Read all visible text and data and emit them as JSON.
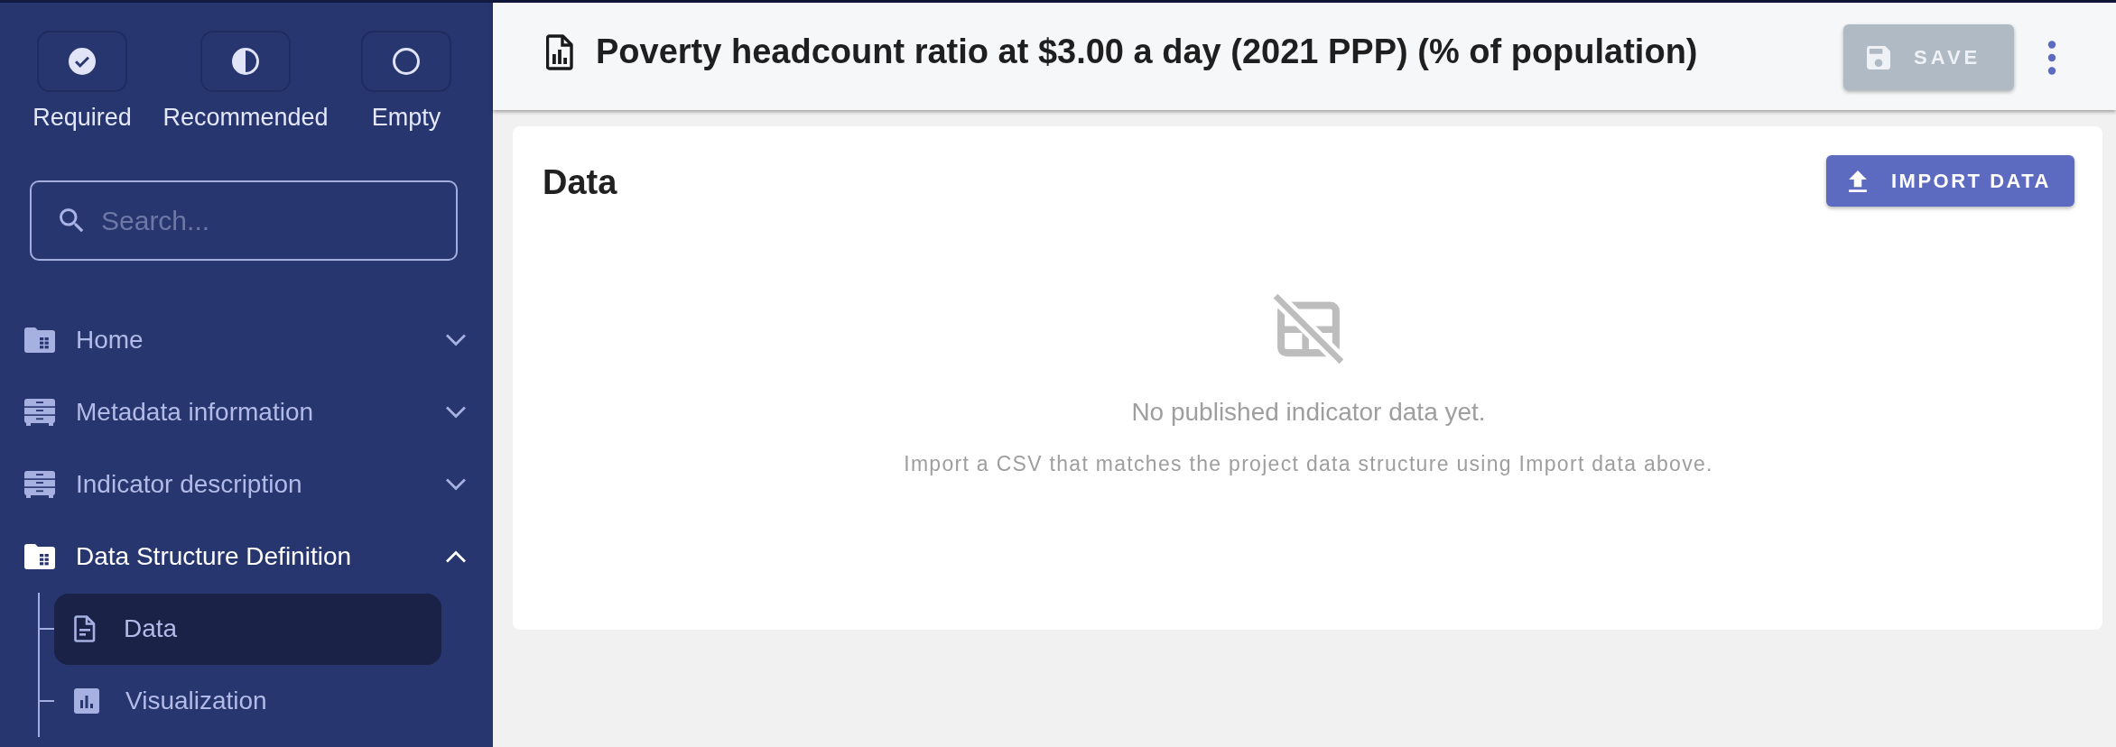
{
  "sidebar": {
    "filters": [
      {
        "label": "Required",
        "kind": "required",
        "selected": false
      },
      {
        "label": "Recommended",
        "kind": "recommended",
        "selected": false
      },
      {
        "label": "Empty",
        "kind": "empty",
        "selected": false
      }
    ],
    "search": {
      "placeholder": "Search..."
    },
    "nav": [
      {
        "label": "Home",
        "kind": "folder",
        "expanded": false
      },
      {
        "label": "Metadata information",
        "kind": "cabinet",
        "expanded": false
      },
      {
        "label": "Indicator description",
        "kind": "cabinet",
        "expanded": false
      },
      {
        "label": "Data Structure Definition",
        "kind": "folder",
        "expanded": true,
        "children": [
          {
            "label": "Data",
            "kind": "document",
            "selected": true
          },
          {
            "label": "Visualization",
            "kind": "chart",
            "selected": false
          }
        ]
      }
    ]
  },
  "header": {
    "title": "Poverty headcount ratio at $3.00 a day (2021 PPP) (% of population)",
    "save_button": {
      "label": "SAVE",
      "disabled": true
    }
  },
  "data_panel": {
    "title": "Data",
    "import_button": {
      "label": "IMPORT DATA"
    },
    "empty_state": {
      "message": "No published indicator data yet.",
      "hint": "Import a CSV that matches the project data structure using Import data above."
    }
  }
}
